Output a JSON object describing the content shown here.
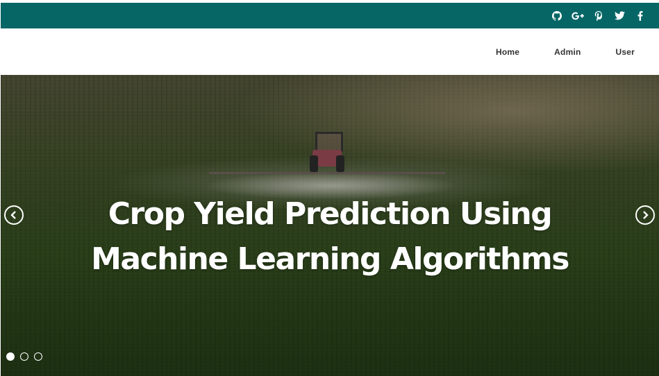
{
  "topbar": {
    "social_icons": [
      "github-icon",
      "google-plus-icon",
      "pinterest-icon",
      "twitter-icon",
      "facebook-icon"
    ],
    "background_color": "#066666"
  },
  "nav": {
    "items": [
      {
        "label": "Home"
      },
      {
        "label": "Admin"
      },
      {
        "label": "User"
      }
    ]
  },
  "hero": {
    "title_line1": "Crop Yield Prediction Using",
    "title_line2": "Machine Learning Algorithms",
    "slides_count": 3,
    "active_slide": 1
  }
}
